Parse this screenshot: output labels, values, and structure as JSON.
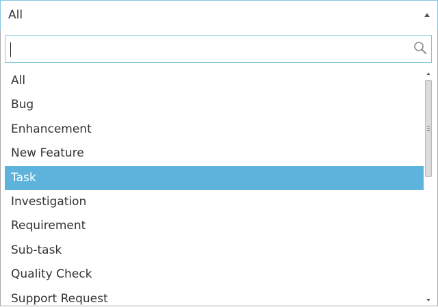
{
  "select": {
    "selected_value": "All"
  },
  "search": {
    "value": "",
    "placeholder": ""
  },
  "options": [
    {
      "label": "All",
      "selected": false
    },
    {
      "label": "Bug",
      "selected": false
    },
    {
      "label": "Enhancement",
      "selected": false
    },
    {
      "label": "New Feature",
      "selected": false
    },
    {
      "label": "Task",
      "selected": true
    },
    {
      "label": "Investigation",
      "selected": false
    },
    {
      "label": "Requirement",
      "selected": false
    },
    {
      "label": "Sub-task",
      "selected": false
    },
    {
      "label": "Quality Check",
      "selected": false
    },
    {
      "label": "Support Request",
      "selected": false
    }
  ],
  "colors": {
    "accent_border": "#84c5e1",
    "highlight": "#5eb3dc",
    "text": "#333333"
  },
  "icons": {
    "search": "search-icon",
    "caret": "caret-up-icon"
  }
}
